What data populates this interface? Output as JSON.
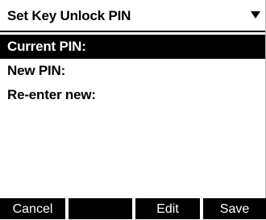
{
  "title_bar": {
    "title": "Set Key Unlock PIN",
    "dropdown_icon": "down-triangle-icon"
  },
  "fields": [
    {
      "label": "Current PIN:",
      "selected": true
    },
    {
      "label": "New PIN:",
      "selected": false
    },
    {
      "label": "Re-enter new:",
      "selected": false
    }
  ],
  "softkeys": {
    "cancel": "Cancel",
    "blank": "",
    "edit": "Edit",
    "save": "Save"
  },
  "colors": {
    "background": "#ffffff",
    "highlight": "#000000",
    "highlight_text": "#ffffff"
  }
}
